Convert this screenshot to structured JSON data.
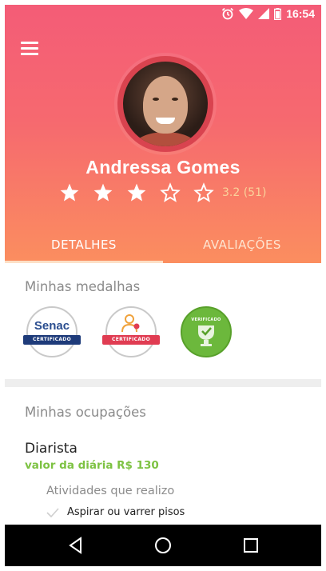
{
  "status_bar": {
    "time": "16:54",
    "icons": [
      "alarm-icon",
      "wifi-icon",
      "signal-icon",
      "battery-icon"
    ]
  },
  "header": {
    "menu_icon": "hamburger-menu-icon"
  },
  "profile": {
    "name": "Andressa Gomes",
    "rating_value": 3.2,
    "rating_max": 5,
    "rating_text": "3.2 (51)"
  },
  "tabs": [
    {
      "label": "DETALHES",
      "selected": true
    },
    {
      "label": "AVALIAÇÕES",
      "selected": false
    }
  ],
  "medals": {
    "title": "Minhas medalhas",
    "items": [
      {
        "name": "senac",
        "logo": "Senac",
        "ribbon": "CERTIFICADO"
      },
      {
        "name": "certificado",
        "ribbon": "CERTIFICADO"
      },
      {
        "name": "verificado",
        "label": "VERIFICADO"
      }
    ]
  },
  "occupations": {
    "title": "Minhas ocupações",
    "job": "Diarista",
    "price": "valor da diária R$ 130",
    "activities_title": "Atividades que realizo",
    "activities": [
      "Aspirar ou varrer pisos"
    ]
  },
  "colors": {
    "header_top": "#f45c77",
    "header_bottom": "#fb8e5f",
    "accent_green": "#7dc242",
    "rating_text": "#f9d29a"
  },
  "navbar": {
    "icons": [
      "back-icon",
      "home-icon",
      "recents-icon"
    ]
  }
}
